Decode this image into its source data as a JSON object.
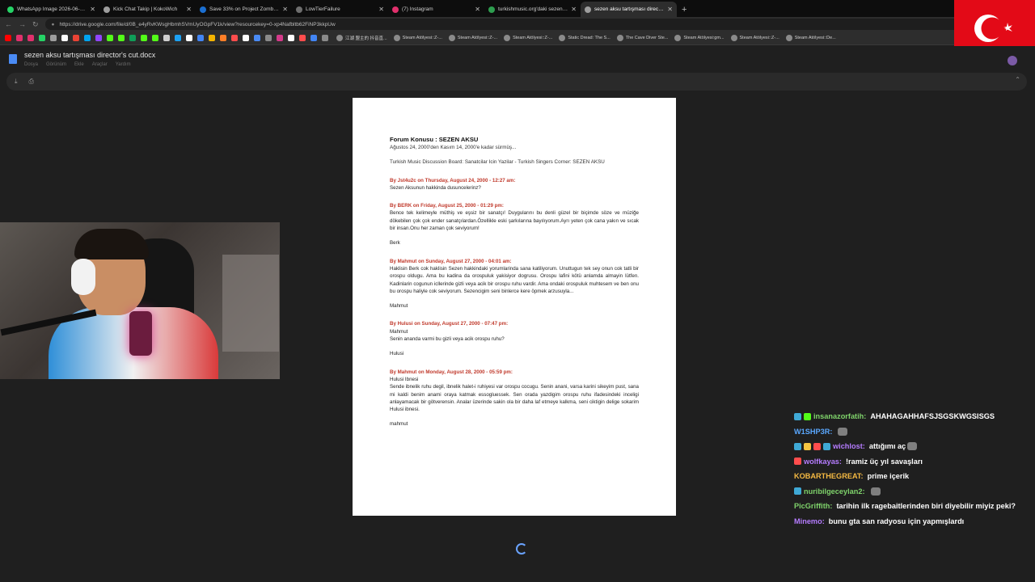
{
  "browser": {
    "tabs": [
      {
        "title": "WhatsApp Image 2026-06-28 at 0",
        "color": "#25d366"
      },
      {
        "title": "Kick Chat Takip | KokoWich",
        "color": "#9e9e9e"
      },
      {
        "title": "Save 33% on Project Zomboid on",
        "color": "#1b6fd1"
      },
      {
        "title": "LowTierFailure",
        "color": "#6e6e6e"
      },
      {
        "title": "(7) Instagram",
        "color": "#e1306c"
      },
      {
        "title": "turkishmusic.org'daki sezen aksu",
        "color": "#2e9e4f"
      },
      {
        "title": "sezen aksu tartışması director's cut",
        "color": "#9e9e9e",
        "active": true
      }
    ],
    "url": "https://drive.google.com/file/d/0B_e4yRvKWsgHbmhSVmUyOGpFV1k/view?resourcekey=0-xp4Nafbltb62FiNP3kkpUw",
    "bookmarks": [
      "江湖 盟主的 抖音直...",
      "Steam Atölyesi::Z-...",
      "Steam Atölyesi::Z-...",
      "Steam Atölyesi::Z-...",
      "Static Dread: The S...",
      "The Cave Diver Ste...",
      "Steam Atölyesi:gm...",
      "Steam Atölyesi::Z-...",
      "Steam Atölyesi::De..."
    ]
  },
  "doc": {
    "title": "sezen aksu tartışması director's cut.docx",
    "menu": [
      "Dosya",
      "Görünüm",
      "Ekle",
      "Araçlar",
      "Yardım"
    ]
  },
  "page": {
    "title": "Forum Konusu : SEZEN AKSU",
    "subtitle": "Ağustos 24, 2000'den Kasım 14, 2000'e kadar sürmüş...",
    "board": "Turkish Music Discussion Board: Sanatcilar Icin Yazilar - Turkish Singers Corner: SEZEN AKSU",
    "posts": [
      {
        "head": "By Jst4u2c on Thursday, August 24, 2000 - 12:27 am:",
        "body": "Sezen Aksunun hakkinda dusuncelerinz?",
        "sign": ""
      },
      {
        "head": "By BERK on Friday, August 25, 2000 - 01:29 pm:",
        "body": "Bence tek kelimeyle müthiş ve eşsiz bir sanatçı! Duygularını bu denli güzel bir biçimde söze ve müziğe dökebilen çok çok ender sanatçılardan.Özellikle eski şarkılarına bayılıyorum.Ayrı yeten çok cana yakın ve sıcak bir insan.Onu her zaman çok seviyorum!",
        "sign": "Berk"
      },
      {
        "head": "By Mahmut on Sunday, August 27, 2000 - 04:01 am:",
        "body": "Haklisin Berk cok haklisin Sezen hakkindaki yorumlarinda sana katiliyorum. Unuttugun tek sey onun cok tatli bir orospu oldugu. Ama bu kadina da orospuluk yakisiyor dogrusu. Orospu lafini kötü anlamda almayin lütfen. Kadinlarin cogunun icllerinde gizli veya acik bir orospu ruhu vardir. Ama ondaki orospuluk muhtesem ve ben onu bu orospu haliyle cok seviyorum. Sezencigim seni binlerce kere öpmek arzusuyla...",
        "sign": "Mahmut"
      },
      {
        "head": "By Hulusi on Sunday, August 27, 2000 - 07:47 pm:",
        "body": "Mahmut\nSenin ananda varmi bu gizli veya acik orospu ruhu?",
        "sign": "Hulusi"
      },
      {
        "head": "By Mahmut on Monday, August 28, 2000 - 05:59 pm:",
        "body": "Hulusi Ibnesi\nSende ibnelik ruhu degil, ibnelik halet-i ruhiyesi var orospu cocugu. Senin anani, varsa karini sikeyim pust, sana mi kaldi benim anami oraya katmak essogluessek. Sen orada yazdigim orospu ruhu ifadesindeki inceligi anlayamacak bir götverensin. Analar üzerinde sakin ola bir daha laf etmeye kalkma, seni ciktigin delige sokarim Hulusi ibnesi.",
        "sign": "mahmut"
      }
    ]
  },
  "chat": [
    {
      "user": "insanazorfatih:",
      "color": "#7fd36b",
      "msg": "AHAHAGAHHAFSJSGSKWGSISGS",
      "badges": [
        "#3fa9d6",
        "#53fc18"
      ]
    },
    {
      "user": "W1SHP3R:",
      "color": "#5aa8ff",
      "msg": "",
      "badges": [],
      "emote": true
    },
    {
      "user": "wichlost:",
      "color": "#b57cff",
      "msg": "attığımı aç",
      "badges": [
        "#3fa9d6",
        "#f5c542",
        "#ff4d4d",
        "#3fa9d6"
      ],
      "emote": true
    },
    {
      "user": "wolfkayas:",
      "color": "#b57cff",
      "msg": "!ramiz üç yıl savaşları",
      "badges": [
        "#ff4d4d"
      ]
    },
    {
      "user": "KOBARTHEGREAT:",
      "color": "#f5b942",
      "msg": "prime içerik",
      "badges": []
    },
    {
      "user": "nuribilgeceylan2:",
      "color": "#7fd36b",
      "msg": "",
      "badges": [
        "#3fa9d6"
      ],
      "emote": true
    },
    {
      "user": "PicGriffith:",
      "color": "#7fd36b",
      "msg": "tarihin ilk ragebaitlerinden biri diyebilir miyiz peki?",
      "badges": []
    },
    {
      "user": "Minemo:",
      "color": "#b57cff",
      "msg": "bunu gta san radyosu için yapmışlardı",
      "badges": []
    }
  ]
}
